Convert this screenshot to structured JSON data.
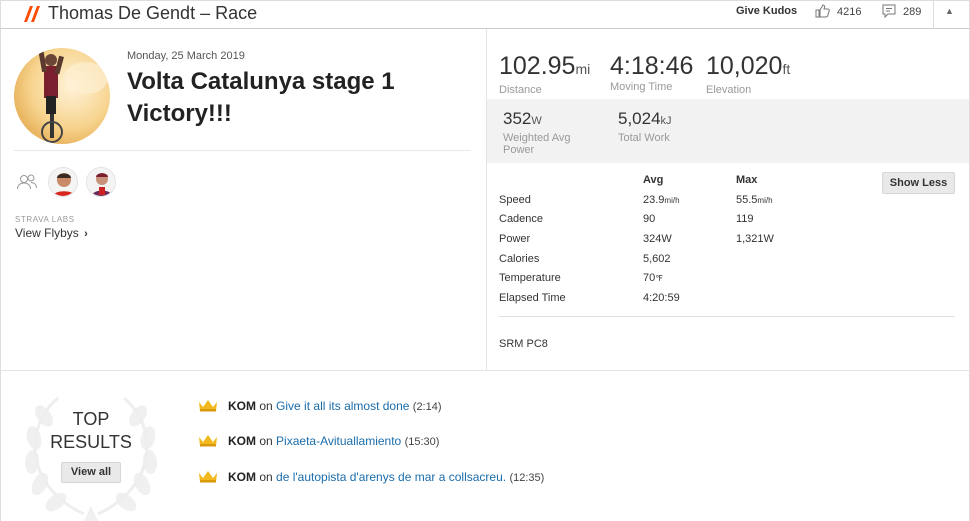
{
  "header": {
    "title": "Thomas De Gendt – Race",
    "give_kudos": "Give Kudos",
    "kudos_count": "4216",
    "comment_count": "289",
    "collapse": "▲"
  },
  "activity": {
    "date": "Monday, 25 March 2019",
    "name": "Volta Catalunya stage 1 Victory!!!"
  },
  "labs": {
    "label": "STRAVA LABS",
    "flybys": "View Flybys"
  },
  "stats": {
    "distance": {
      "value": "102.95",
      "unit": "mi",
      "label": "Distance"
    },
    "moving_time": {
      "value": "4:18:46",
      "label": "Moving Time"
    },
    "elevation": {
      "value": "10,020",
      "unit": "ft",
      "label": "Elevation"
    },
    "weighted_power": {
      "value": "352",
      "unit": "W",
      "label_line1": "Weighted Avg",
      "label_line2": "Power"
    },
    "total_work": {
      "value": "5,024",
      "unit": "kJ",
      "label": "Total Work"
    }
  },
  "details": {
    "avg_header": "Avg",
    "max_header": "Max",
    "show_less": "Show Less",
    "rows": [
      {
        "label": "Speed",
        "avg": "23.9",
        "avg_unit": "mi/h",
        "max": "55.5",
        "max_unit": "mi/h"
      },
      {
        "label": "Cadence",
        "avg": "90",
        "avg_unit": "",
        "max": "119",
        "max_unit": ""
      },
      {
        "label": "Power",
        "avg": "324",
        "avg_unit": "W",
        "max": "1,321",
        "max_unit": "W"
      },
      {
        "label": "Calories",
        "avg": "5,602",
        "avg_unit": "",
        "max": "",
        "max_unit": ""
      },
      {
        "label": "Temperature",
        "avg": "70",
        "avg_unit": "℉",
        "max": "",
        "max_unit": ""
      },
      {
        "label": "Elapsed Time",
        "avg": "4:20:59",
        "avg_unit": "",
        "max": "",
        "max_unit": ""
      }
    ],
    "device": "SRM PC8"
  },
  "results": {
    "top_line1": "TOP",
    "top_line2": "RESULTS",
    "view_all": "View all",
    "koms": [
      {
        "badge": "KOM",
        "on": "on",
        "segment": "Give it all its almost done",
        "time": "(2:14)"
      },
      {
        "badge": "KOM",
        "on": "on",
        "segment": "Pixaeta-Avituallamiento",
        "time": "(15:30)"
      },
      {
        "badge": "KOM",
        "on": "on",
        "segment": "de l'autopista d'arenys de mar a collsacreu.",
        "time": "(12:35)"
      }
    ]
  },
  "colors": {
    "brand_orange": "#fc4c02",
    "link_blue": "#1a6cab",
    "crown_gold": "#f1b91d",
    "stats_bg": "#f2f2f2"
  },
  "icons": {
    "brand": "strava-chevrons-icon",
    "kudos": "thumbs-up-icon",
    "comments": "comment-icon",
    "group": "group-icon",
    "crown": "crown-icon",
    "wreath": "laurel-wreath-icon"
  }
}
